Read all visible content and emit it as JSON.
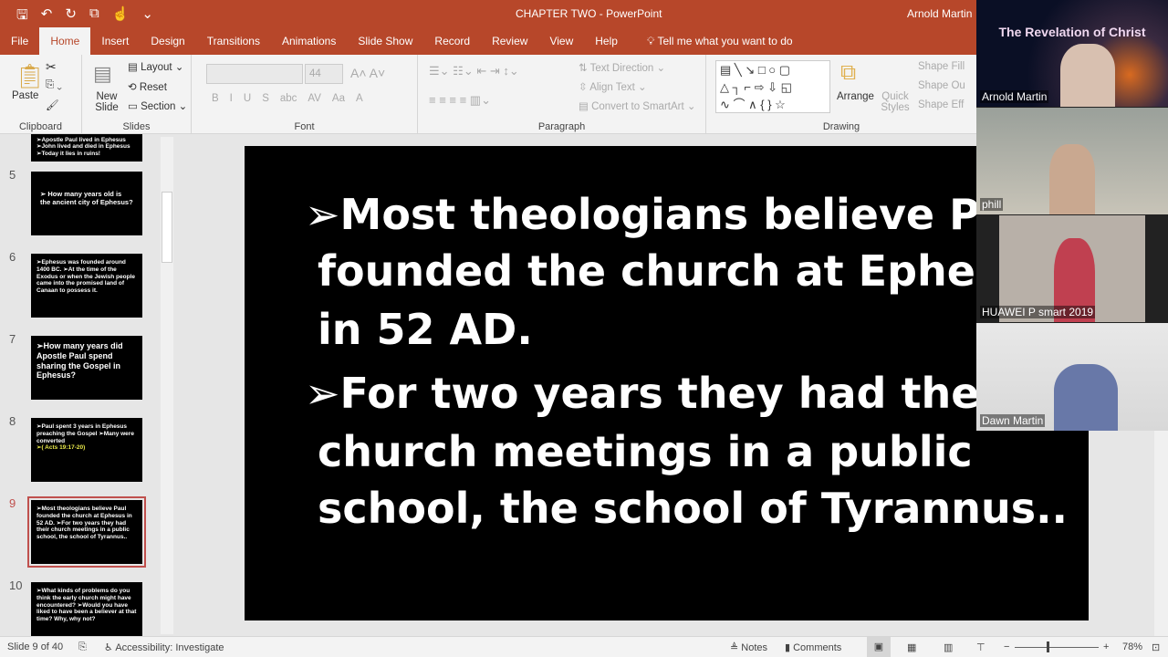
{
  "titlebar": {
    "doc_title": "CHAPTER TWO  -  PowerPoint",
    "user": "Arnold Martin"
  },
  "tabs": [
    "File",
    "Home",
    "Insert",
    "Design",
    "Transitions",
    "Animations",
    "Slide Show",
    "Record",
    "Review",
    "View",
    "Help"
  ],
  "tell_me": "Tell me what you want to do",
  "ribbon": {
    "clipboard": {
      "label": "Clipboard",
      "paste": "Paste"
    },
    "slides": {
      "label": "Slides",
      "new_slide": "New Slide",
      "layout": "Layout",
      "reset": "Reset",
      "section": "Section"
    },
    "font": {
      "label": "Font",
      "size": "44",
      "bold": "B",
      "italic": "I",
      "underline": "U",
      "shadow": "S",
      "strike": "abc",
      "spacing": "AV",
      "case": "Aa",
      "color": "A"
    },
    "paragraph": {
      "label": "Paragraph",
      "text_direction": "Text Direction",
      "align_text": "Align Text",
      "smartart": "Convert to SmartArt"
    },
    "drawing": {
      "label": "Drawing",
      "arrange": "Arrange",
      "quick_styles": "Quick Styles",
      "shape_fill": "Shape Fill",
      "shape_outline": "Shape Ou",
      "shape_effects": "Shape Eff"
    }
  },
  "thumbnails": [
    {
      "num": "",
      "text": "➢Apostle Paul lived in Ephesus ➢John lived and died in Ephesus ➢Today it lies in ruins!"
    },
    {
      "num": "5",
      "text": "➢ How many years old is the ancient city of Ephesus?"
    },
    {
      "num": "6",
      "text": "➢Ephesus was founded around 1400 BC. ➢At the time of the Exodus or when the Jewish people came into the promised land of Canaan to possess it."
    },
    {
      "num": "7",
      "text": "➢How many years did Apostle Paul spend sharing the Gospel in Ephesus?"
    },
    {
      "num": "8",
      "text": "➢Paul spent 3 years in Ephesus preaching the Gospel ➢Many were converted",
      "extra": "➢( Acts 19:17-20)"
    },
    {
      "num": "9",
      "text": "➢Most theologians believe Paul founded the church at Ephesus in 52 AD. ➢For two years they had their church meetings in a public school, the school of Tyrannus.."
    },
    {
      "num": "10",
      "text": "➢What kinds of problems do you think the early church might have encountered? ➢Would you have liked to have been a believer at that time? Why, why not?"
    }
  ],
  "slide": {
    "lines": [
      "➢Most theologians believe Paul",
      "founded the church at Ephesus",
      "in 52 AD.",
      "➢For two years they had their",
      "church meetings in a public",
      "school, the school of Tyrannus.."
    ]
  },
  "video": {
    "banner": "The Revelation of Christ",
    "participants": [
      "Arnold Martin",
      "phill",
      "HUAWEI P smart 2019",
      "Dawn Martin"
    ]
  },
  "status": {
    "slide": "Slide 9 of 40",
    "accessibility": "Accessibility: Investigate",
    "notes": "Notes",
    "comments": "Comments",
    "zoom": "78%"
  }
}
